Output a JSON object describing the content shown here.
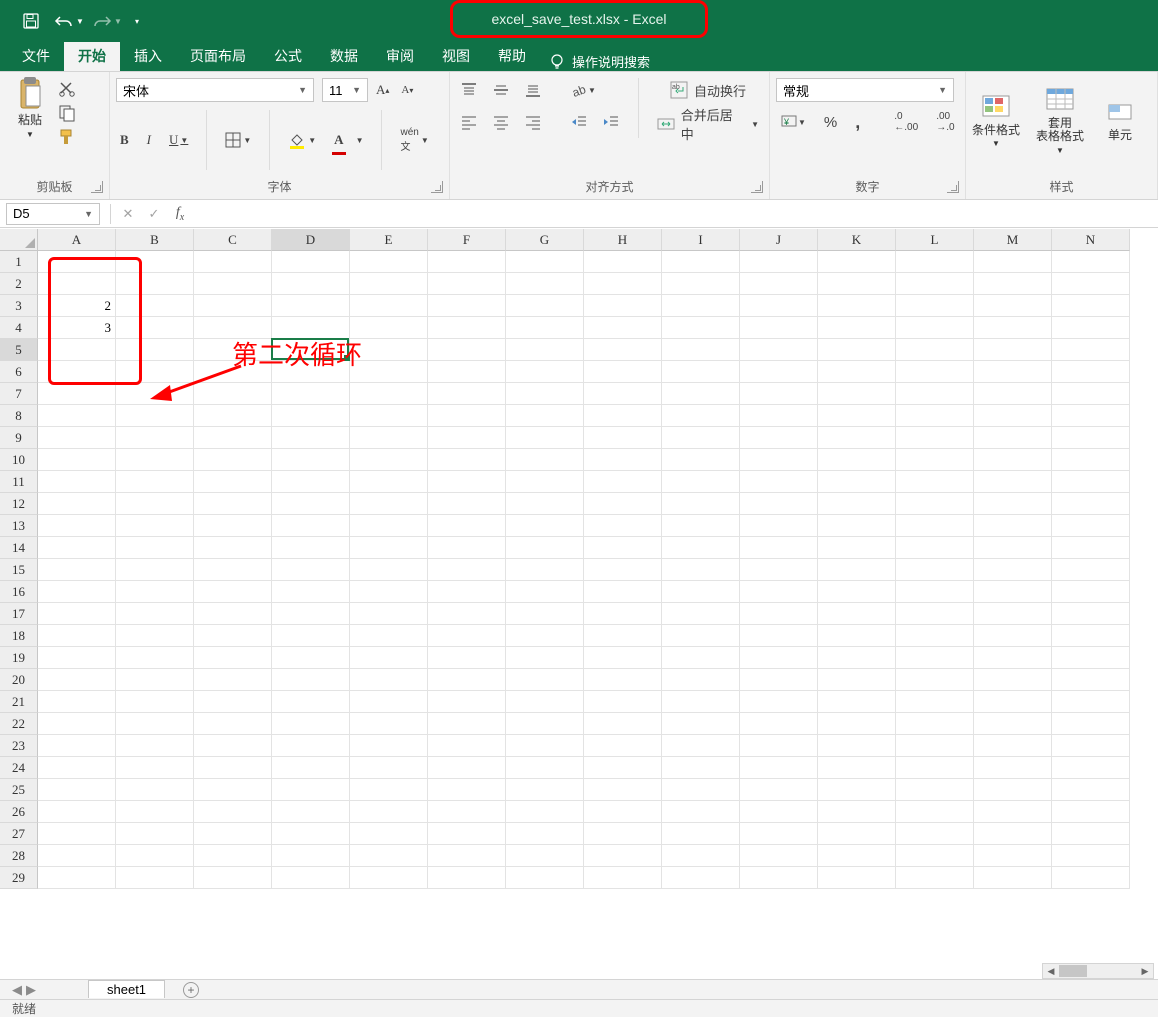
{
  "window": {
    "title": "excel_save_test.xlsx  -  Excel"
  },
  "qat": {
    "save": "save-icon",
    "undo": "undo-icon",
    "redo": "redo-icon"
  },
  "tabs": {
    "items": [
      "文件",
      "开始",
      "插入",
      "页面布局",
      "公式",
      "数据",
      "审阅",
      "视图",
      "帮助"
    ],
    "active_index": 1,
    "search_hint": "操作说明搜索"
  },
  "ribbon": {
    "clipboard": {
      "label": "剪贴板",
      "paste": "粘贴"
    },
    "font": {
      "label": "字体",
      "name": "宋体",
      "size": "11",
      "bold": "B",
      "italic": "I",
      "underline": "U"
    },
    "alignment": {
      "label": "对齐方式",
      "wrap": "自动换行",
      "merge": "合并后居中"
    },
    "number": {
      "label": "数字",
      "format": "常规"
    },
    "styles": {
      "label": "样式",
      "cond": "条件格式",
      "table": "套用\n表格格式",
      "cell": "单元"
    }
  },
  "namebox": {
    "value": "D5"
  },
  "formula": {
    "value": ""
  },
  "grid": {
    "columns": [
      "A",
      "B",
      "C",
      "D",
      "E",
      "F",
      "G",
      "H",
      "I",
      "J",
      "K",
      "L",
      "M",
      "N"
    ],
    "row_count": 29,
    "active_col_index": 3,
    "active_row_index": 4,
    "cells": {
      "A3": "2",
      "A4": "3"
    }
  },
  "annotations": {
    "box_label": "",
    "text": "第二次循环"
  },
  "sheet_tabs": {
    "active": "sheet1"
  },
  "status": {
    "text": "就绪"
  }
}
